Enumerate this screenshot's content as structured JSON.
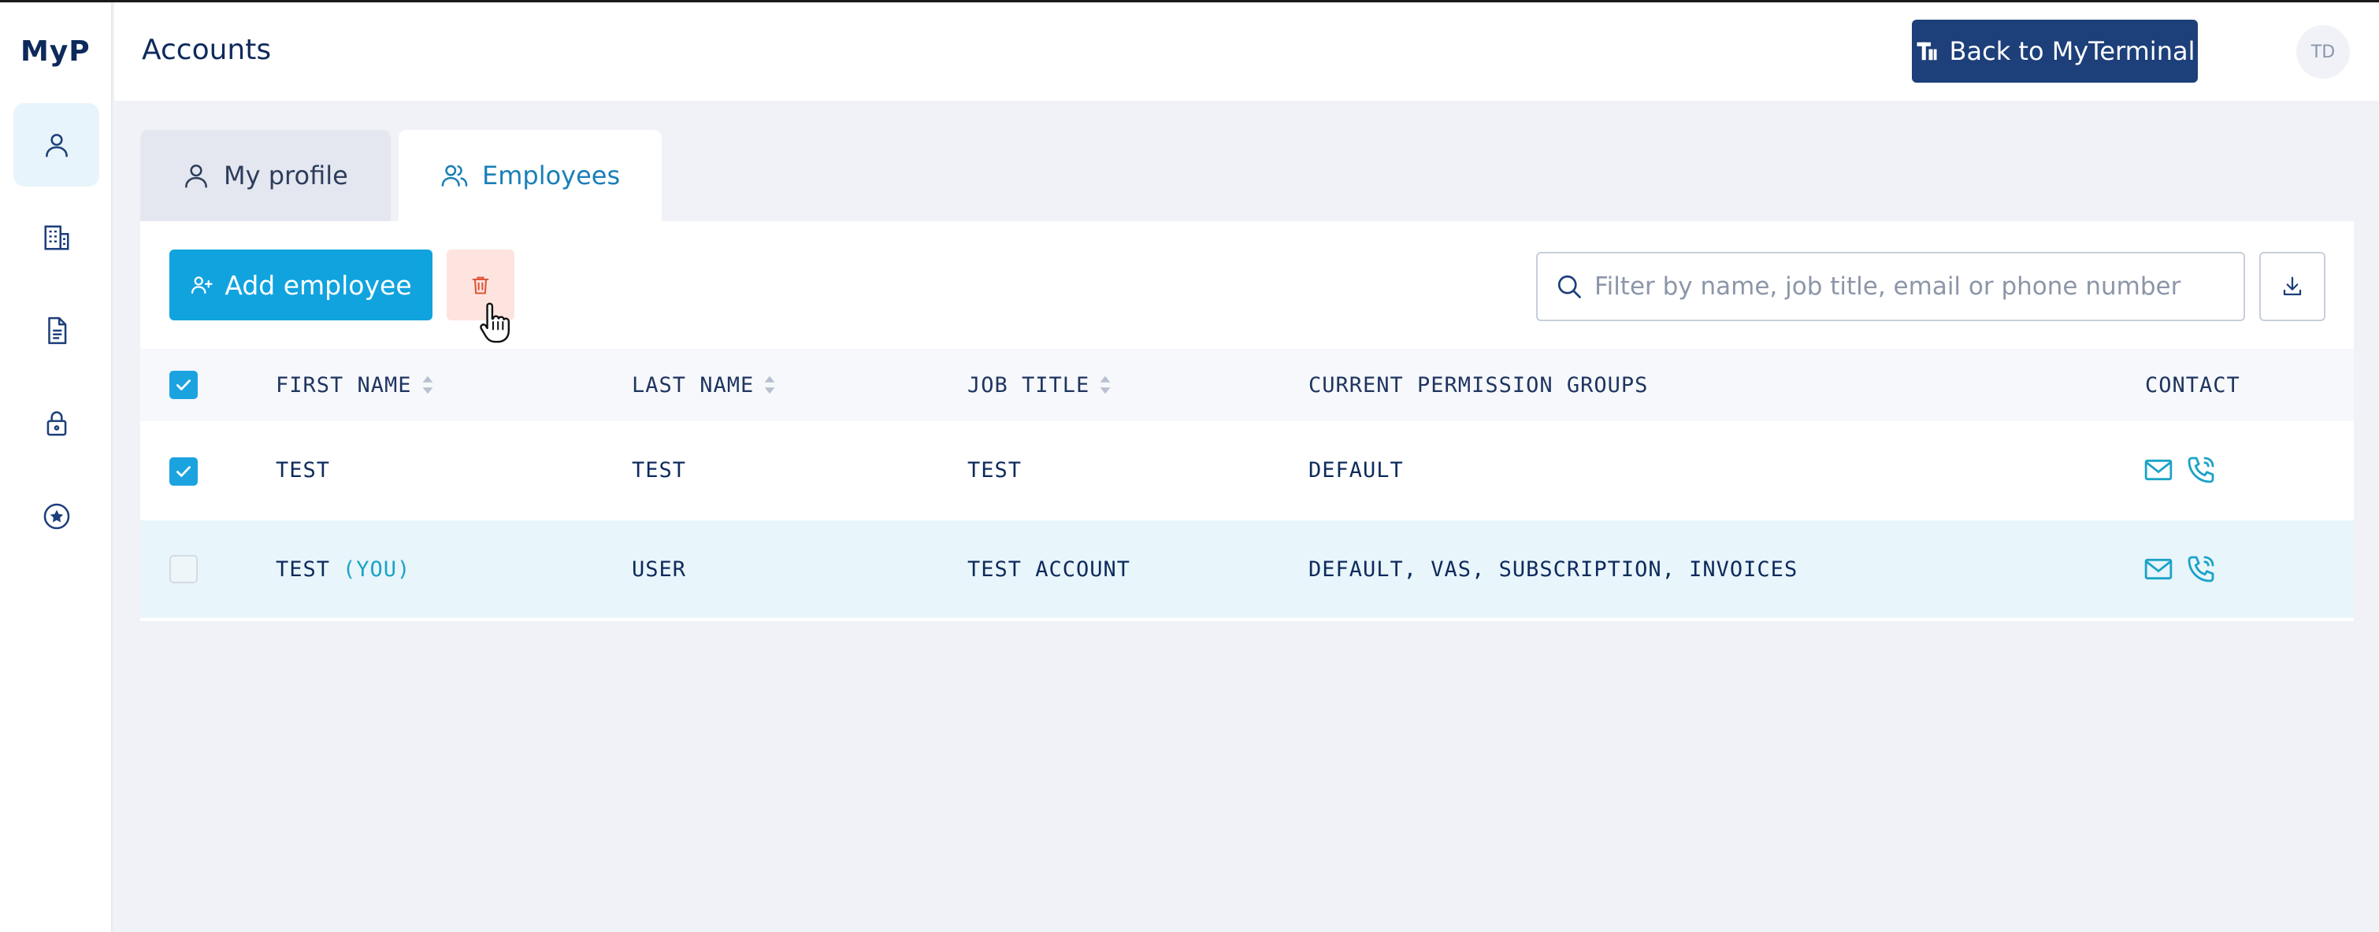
{
  "app": {
    "logo": "MyP"
  },
  "sidebar": {
    "items": [
      {
        "icon": "user-icon",
        "active": true
      },
      {
        "icon": "building-icon",
        "active": false
      },
      {
        "icon": "document-icon",
        "active": false
      },
      {
        "icon": "lock-icon",
        "active": false
      },
      {
        "icon": "star-circle-icon",
        "active": false
      }
    ]
  },
  "header": {
    "title": "Accounts",
    "back_button": "Back to MyTerminal",
    "avatar_initials": "TD"
  },
  "tabs": [
    {
      "label": "My profile",
      "active": false
    },
    {
      "label": "Employees",
      "active": true
    }
  ],
  "toolbar": {
    "add_label": "Add employee",
    "search_placeholder": "Filter by name, job title, email or phone number",
    "search_value": ""
  },
  "table": {
    "columns": [
      "FIRST NAME",
      "LAST NAME",
      "JOB TITLE",
      "CURRENT PERMISSION GROUPS",
      "CONTACT"
    ],
    "header_checked": true,
    "rows": [
      {
        "checked": true,
        "first_name": "TEST",
        "you_tag": "",
        "last_name": "TEST",
        "job_title": "TEST",
        "groups": "DEFAULT"
      },
      {
        "checked": false,
        "first_name": "TEST",
        "you_tag": "(YOU)",
        "last_name": "USER",
        "job_title": "TEST ACCOUNT",
        "groups": "DEFAULT, VAS, SUBSCRIPTION, INVOICES"
      }
    ]
  },
  "colors": {
    "primary": "#11a3de",
    "navy": "#1d3f7a",
    "danger_bg": "#fde4df",
    "danger": "#e0553a",
    "highlight_row": "#e8f5fb"
  }
}
